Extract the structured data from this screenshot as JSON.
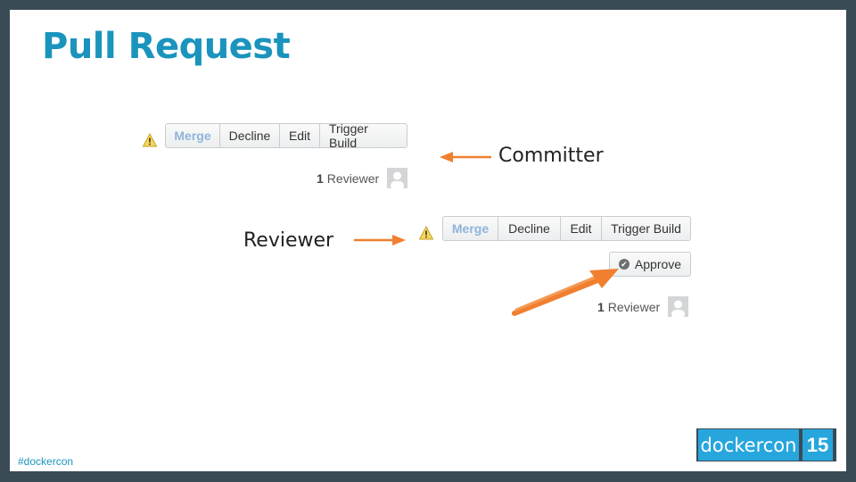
{
  "slide": {
    "title": "Pull Request",
    "hashtag": "#dockercon"
  },
  "committer_view": {
    "buttons": [
      "Merge",
      "Decline",
      "Edit",
      "Trigger Build"
    ],
    "reviewer_count": "1",
    "reviewer_label": "Reviewer"
  },
  "reviewer_view": {
    "buttons": [
      "Merge",
      "Decline",
      "Edit",
      "Trigger Build"
    ],
    "approve_label": "Approve",
    "reviewer_count": "1",
    "reviewer_label": "Reviewer"
  },
  "annotations": {
    "committer": "Committer",
    "reviewer": "Reviewer"
  },
  "logo": {
    "brand": "dockercon",
    "number": "15"
  },
  "colors": {
    "title": "#1a94bd",
    "arrow": "#f07f2f",
    "background": "#3b4b55",
    "logo": "#27a6dd"
  }
}
